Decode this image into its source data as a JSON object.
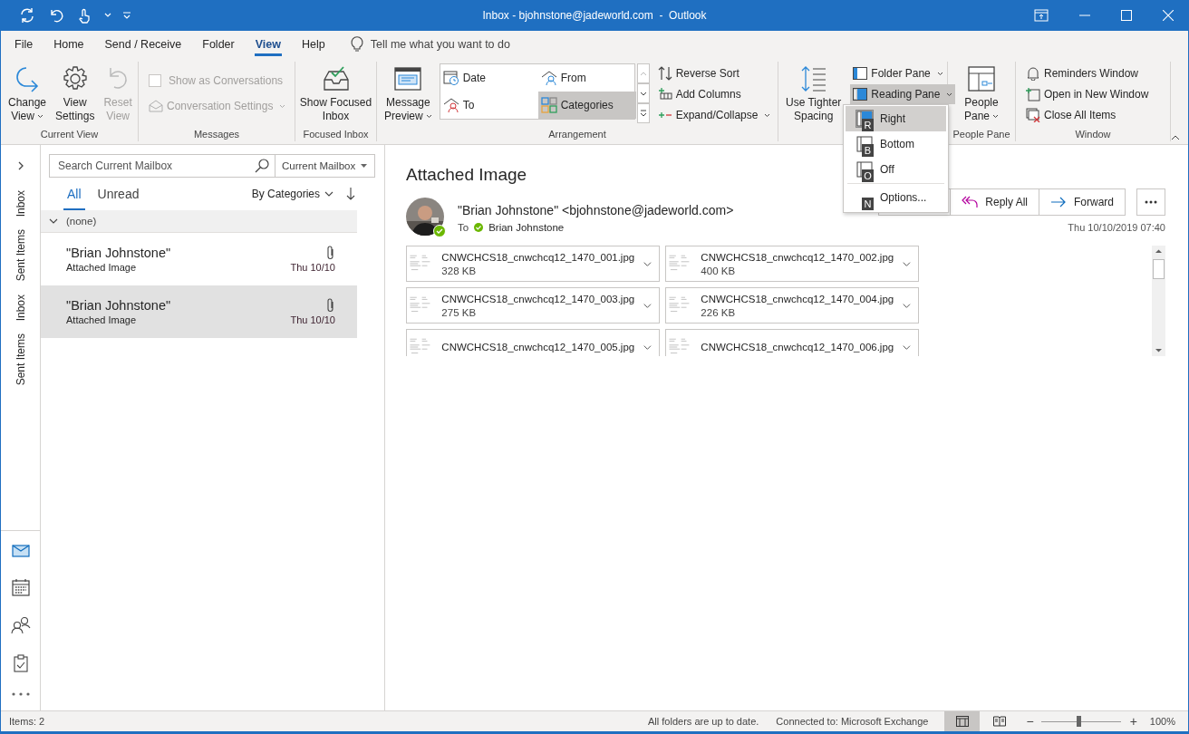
{
  "window": {
    "title": "Inbox - bjohnstone@jadeworld.com  -  Outlook"
  },
  "menu_tabs": [
    {
      "label": "File",
      "selected": false
    },
    {
      "label": "Home",
      "selected": false
    },
    {
      "label": "Send / Receive",
      "selected": false
    },
    {
      "label": "Folder",
      "selected": false
    },
    {
      "label": "View",
      "selected": true
    },
    {
      "label": "Help",
      "selected": false
    }
  ],
  "tell_me": {
    "placeholder": "Tell me what you want to do"
  },
  "ribbon": {
    "current_view": {
      "label": "Current View",
      "buttons": [
        {
          "lines": [
            "Change",
            "View"
          ],
          "disabled": false
        },
        {
          "lines": [
            "View",
            "Settings"
          ],
          "disabled": false
        },
        {
          "lines": [
            "Reset",
            "View"
          ],
          "disabled": true
        }
      ]
    },
    "messages": {
      "label": "Messages",
      "show_as_conversations": {
        "label": "Show as Conversations",
        "checked": false,
        "disabled": true
      },
      "conversation_settings": {
        "label": "Conversation Settings",
        "disabled": true
      }
    },
    "focused_inbox": {
      "label": "Focused Inbox",
      "button": {
        "lines": [
          "Show Focused",
          "Inbox"
        ]
      }
    },
    "arrangement": {
      "label": "Arrangement",
      "message_preview": {
        "lines": [
          "Message",
          "Preview"
        ]
      },
      "options": [
        {
          "label": "Date",
          "selected": false
        },
        {
          "label": "From",
          "selected": false
        },
        {
          "label": "To",
          "selected": false
        },
        {
          "label": "Categories",
          "selected": true
        }
      ],
      "commands": [
        {
          "label": "Reverse Sort"
        },
        {
          "label": "Add Columns"
        },
        {
          "label": "Expand/Collapse"
        }
      ]
    },
    "layout": {
      "tighter_spacing": {
        "lines": [
          "Use Tighter",
          "Spacing"
        ]
      },
      "folder_pane": {
        "label": "Folder Pane"
      },
      "reading_pane": {
        "label": "Reading Pane",
        "expanded": true
      }
    },
    "people_pane": {
      "label": "People Pane",
      "button": {
        "lines": [
          "People",
          "Pane"
        ]
      }
    },
    "window_group": {
      "label": "Window",
      "commands": [
        {
          "label": "Reminders Window"
        },
        {
          "label": "Open in New Window"
        },
        {
          "label": "Close All Items"
        }
      ]
    }
  },
  "reading_pane_menu": {
    "items": [
      {
        "label": "Right",
        "key": "R",
        "selected": true
      },
      {
        "label": "Bottom",
        "key": "B",
        "selected": false
      },
      {
        "label": "Off",
        "key": "O",
        "selected": false
      },
      {
        "label": "Options...",
        "key": "N",
        "selected": false
      }
    ]
  },
  "folder_shortcuts": [
    {
      "label": "Inbox"
    },
    {
      "label": "Sent Items"
    },
    {
      "label": "Inbox"
    },
    {
      "label": "Sent Items"
    }
  ],
  "mail_list": {
    "search": {
      "placeholder": "Search Current Mailbox"
    },
    "scope": "Current Mailbox",
    "filters": [
      {
        "label": "All",
        "selected": true
      },
      {
        "label": "Unread",
        "selected": false
      }
    ],
    "sort": "By Categories",
    "group": {
      "label": "(none)",
      "expanded": true
    },
    "messages": [
      {
        "sender": "\"Brian Johnstone\"",
        "subject": "Attached Image",
        "date": "Thu 10/10",
        "selected": false
      },
      {
        "sender": "\"Brian Johnstone\"",
        "subject": "Attached Image",
        "date": "Thu 10/10",
        "selected": true
      }
    ]
  },
  "message": {
    "subject": "Attached Image",
    "from": "\"Brian Johnstone\" <bjohnstone@jadeworld.com>",
    "to_label": "To",
    "to": "Brian Johnstone",
    "date": "Thu 10/10/2019 07:40",
    "actions": [
      {
        "label": "Reply All"
      },
      {
        "label": "Forward"
      }
    ],
    "attachments": [
      {
        "name": "CNWCHCS18_cnwchcq12_1470_001.jpg",
        "size": "328 KB"
      },
      {
        "name": "CNWCHCS18_cnwchcq12_1470_002.jpg",
        "size": "400 KB"
      },
      {
        "name": "CNWCHCS18_cnwchcq12_1470_003.jpg",
        "size": "275 KB"
      },
      {
        "name": "CNWCHCS18_cnwchcq12_1470_004.jpg",
        "size": "226 KB"
      },
      {
        "name": "CNWCHCS18_cnwchcq12_1470_005.jpg"
      },
      {
        "name": "CNWCHCS18_cnwchcq12_1470_006.jpg"
      }
    ]
  },
  "status_bar": {
    "items": "Items: 2",
    "sync": "All folders are up to date.",
    "connection": "Connected to: Microsoft Exchange",
    "zoom": {
      "minus": "−",
      "plus": "+",
      "level": 0.47,
      "reading": "100%"
    }
  }
}
